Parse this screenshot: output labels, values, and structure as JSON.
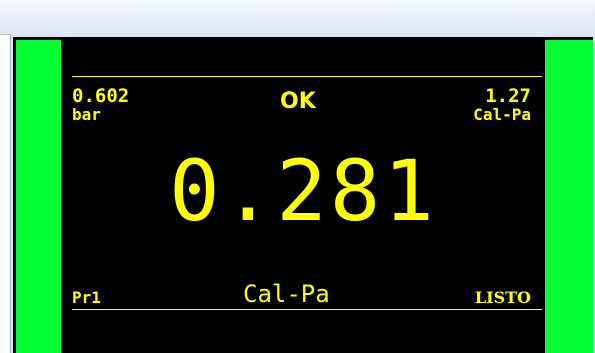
{
  "display": {
    "left_value": "0.602",
    "left_unit": "bar",
    "status": "OK",
    "right_value": "1.27",
    "right_unit": "Cal-Pa",
    "main_value": "0.281",
    "main_unit": "Cal-Pa",
    "bottom_left": "Pr1",
    "bottom_right": "LISTO"
  },
  "colors": {
    "indicator": "#00ff33",
    "text": "#ffff00",
    "background": "#000000"
  }
}
